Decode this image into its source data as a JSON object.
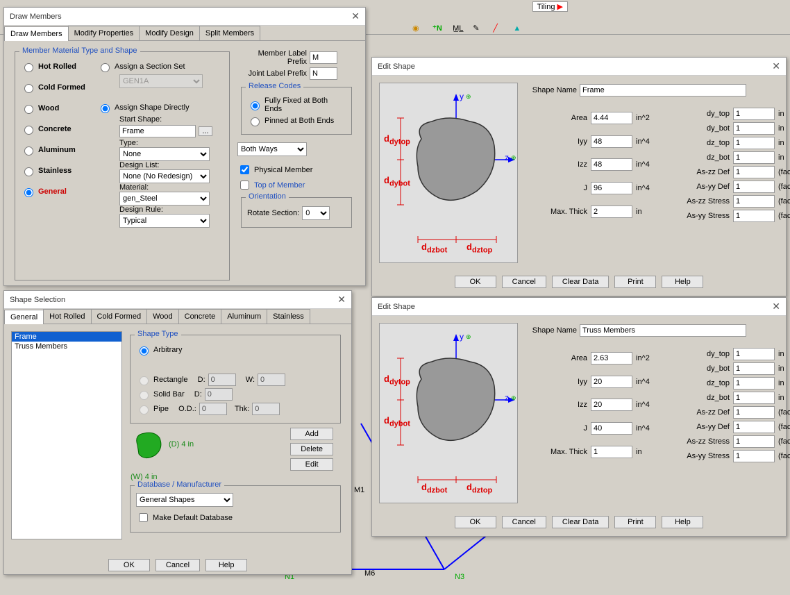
{
  "draw_members": {
    "title": "Draw Members",
    "tabs": [
      "Draw Members",
      "Modify Properties",
      "Modify Design",
      "Split Members"
    ],
    "group1": {
      "legend": "Member Material Type and Shape",
      "materials": [
        "Hot Rolled",
        "Cold Formed",
        "Wood",
        "Concrete",
        "Aluminum",
        "Stainless",
        "General"
      ],
      "assign_section": "Assign a Section Set",
      "section_set": "GEN1A",
      "assign_shape": "Assign Shape Directly",
      "start_shape_lbl": "Start Shape:",
      "start_shape": "Frame",
      "type_lbl": "Type:",
      "type": "None",
      "design_list_lbl": "Design List:",
      "design_list": "None (No Redesign)",
      "material_lbl": "Material:",
      "material": "gen_Steel",
      "design_rule_lbl": "Design Rule:",
      "design_rule": "Typical"
    },
    "member_prefix_lbl": "Member Label Prefix",
    "member_prefix": "M",
    "joint_prefix_lbl": "Joint Label Prefix",
    "joint_prefix": "N",
    "release": {
      "legend": "Release Codes",
      "opt1": "Fully Fixed at Both Ends",
      "opt2": "Pinned at Both Ends"
    },
    "both_ways": "Both Ways",
    "phys_member": "Physical Member",
    "top_member": "Top of Member",
    "orientation": {
      "legend": "Orientation",
      "rotate_lbl": "Rotate Section:",
      "rotate": "0"
    }
  },
  "shape_sel": {
    "title": "Shape Selection",
    "tabs": [
      "General",
      "Hot Rolled",
      "Cold Formed",
      "Wood",
      "Concrete",
      "Aluminum",
      "Stainless"
    ],
    "list": [
      "Frame",
      "Truss Members"
    ],
    "shape_type": {
      "legend": "Shape Type",
      "arbitrary": "Arbitrary",
      "rectangle": "Rectangle",
      "solid_bar": "Solid Bar",
      "pipe": "Pipe",
      "d_lbl": "D:",
      "w_lbl": "W:",
      "od_lbl": "O.D.:",
      "thk_lbl": "Thk:"
    },
    "dim_d": "(D) 4 in",
    "dim_w": "(W) 4 in",
    "add": "Add",
    "delete": "Delete",
    "edit": "Edit",
    "db": {
      "legend": "Database / Manufacturer",
      "value": "General Shapes",
      "make_default": "Make Default Database"
    },
    "ok": "OK",
    "cancel": "Cancel",
    "help": "Help"
  },
  "edit1": {
    "title": "Edit Shape",
    "shape_name_lbl": "Shape Name",
    "shape_name": "Frame",
    "area_lbl": "Area",
    "area": "4.44",
    "area_u": "in^2",
    "iyy_lbl": "Iyy",
    "iyy": "48",
    "iyy_u": "in^4",
    "izz_lbl": "Izz",
    "izz": "48",
    "izz_u": "in^4",
    "j_lbl": "J",
    "j": "96",
    "j_u": "in^4",
    "mt_lbl": "Max. Thick",
    "mt": "2",
    "mt_u": "in",
    "dytop_lbl": "dy_top",
    "dytop": "1",
    "dytop_u": "in",
    "dybot_lbl": "dy_bot",
    "dybot": "1",
    "dybot_u": "in",
    "dztop_lbl": "dz_top",
    "dztop": "1",
    "dztop_u": "in",
    "dzbot_lbl": "dz_bot",
    "dzbot": "1",
    "dzbot_u": "in",
    "aszzd_lbl": "As-zz Def",
    "aszzd": "1",
    "aszzd_u": "(factor)",
    "asyyd_lbl": "As-yy Def",
    "asyyd": "1",
    "asyyd_u": "(factor)",
    "aszzs_lbl": "As-zz Stress",
    "aszzs": "1",
    "aszzs_u": "(factor)",
    "asyys_lbl": "As-yy Stress",
    "asyys": "1",
    "asyys_u": "(factor)",
    "ok": "OK",
    "cancel": "Cancel",
    "clear": "Clear Data",
    "print": "Print",
    "help": "Help",
    "diag": {
      "y": "y",
      "z": "z",
      "dytop": "dytop",
      "dybot": "dybot",
      "dzbot": "dzbot",
      "dztop": "dztop"
    }
  },
  "edit2": {
    "title": "Edit Shape",
    "shape_name_lbl": "Shape Name",
    "shape_name": "Truss Members",
    "area_lbl": "Area",
    "area": "2.63",
    "area_u": "in^2",
    "iyy_lbl": "Iyy",
    "iyy": "20",
    "iyy_u": "in^4",
    "izz_lbl": "Izz",
    "izz": "20",
    "izz_u": "in^4",
    "j_lbl": "J",
    "j": "40",
    "j_u": "in^4",
    "mt_lbl": "Max. Thick",
    "mt": "1",
    "mt_u": "in",
    "dytop_lbl": "dy_top",
    "dytop": "1",
    "dytop_u": "in",
    "dybot_lbl": "dy_bot",
    "dybot": "1",
    "dybot_u": "in",
    "dztop_lbl": "dz_top",
    "dztop": "1",
    "dztop_u": "in",
    "dzbot_lbl": "dz_bot",
    "dzbot": "1",
    "dzbot_u": "in",
    "aszzd_lbl": "As-zz Def",
    "aszzd": "1",
    "aszzd_u": "(factor)",
    "asyyd_lbl": "As-yy Def",
    "asyyd": "1",
    "asyyd_u": "(factor)",
    "aszzs_lbl": "As-zz Stress",
    "aszzs": "1",
    "aszzs_u": "(factor)",
    "asyys_lbl": "As-yy Stress",
    "asyys": "1",
    "asyys_u": "(factor)",
    "ok": "OK",
    "cancel": "Cancel",
    "clear": "Clear Data",
    "print": "Print",
    "help": "Help"
  },
  "bg": {
    "n1": "N1",
    "n3": "N3",
    "m6": "M6",
    "m1": "M1",
    "tiling": "Tiling"
  }
}
